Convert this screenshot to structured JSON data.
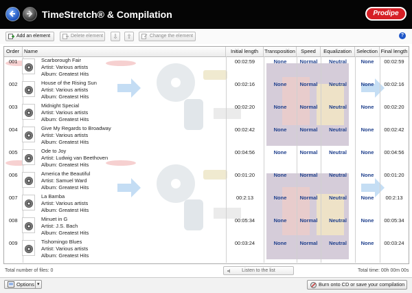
{
  "app": {
    "title": "TimeStretch® & Compilation",
    "logo_text": "Prodipe"
  },
  "toolbar": {
    "add_label": "Add an element",
    "delete_label": "Delete element",
    "change_label": "Change the element",
    "help_label": "?"
  },
  "columns": {
    "order": "Order",
    "name": "Name",
    "initial_length": "Initial length",
    "transposition": "Transposition",
    "speed": "Speed",
    "equalization": "Equalization",
    "selection": "Selection",
    "final_length": "Final length"
  },
  "rows": [
    {
      "order": "001",
      "title": "Scarborough Fair",
      "artist": "Artist: Various artists",
      "album": "Album: Greatest Hits",
      "initial": "00:02:59",
      "transposition": "None",
      "speed": "Normal",
      "equalization": "Neutral",
      "selection": "None",
      "final": "00:02:59"
    },
    {
      "order": "002",
      "title": "House of the Rising Sun",
      "artist": "Artist: Various artists",
      "album": "Album: Greatest Hits",
      "initial": "00:02:16",
      "transposition": "None",
      "speed": "Normal",
      "equalization": "Neutral",
      "selection": "None",
      "final": "00:02:16"
    },
    {
      "order": "003",
      "title": "Midnight Special",
      "artist": "Artist: Various artists",
      "album": "Album: Greatest Hits",
      "initial": "00:02:20",
      "transposition": "None",
      "speed": "Normal",
      "equalization": "Neutral",
      "selection": "None",
      "final": "00:02:20"
    },
    {
      "order": "004",
      "title": "Give My Regards to Broadway",
      "artist": "Artist: Various artists",
      "album": "Album: Greatest Hits",
      "initial": "00:02:42",
      "transposition": "None",
      "speed": "Normal",
      "equalization": "Neutral",
      "selection": "None",
      "final": "00:02:42"
    },
    {
      "order": "005",
      "title": "Ode to Joy",
      "artist": "Artist: Ludwig van Beethoven",
      "album": "Album: Greatest Hits",
      "initial": "00:04:56",
      "transposition": "None",
      "speed": "Normal",
      "equalization": "Neutral",
      "selection": "None",
      "final": "00:04:56"
    },
    {
      "order": "006",
      "title": "America the Beautiful",
      "artist": "Artist: Samuel Ward",
      "album": "Album: Greatest Hits",
      "initial": "00:01:20",
      "transposition": "None",
      "speed": "Normal",
      "equalization": "Neutral",
      "selection": "None",
      "final": "00:01:20"
    },
    {
      "order": "007",
      "title": "La Bamba",
      "artist": "Artist: Various artists",
      "album": "Album: Greatest Hits",
      "initial": "00:2:13",
      "transposition": "None",
      "speed": "Normal",
      "equalization": "Neutral",
      "selection": "None",
      "final": "00:2:13"
    },
    {
      "order": "008",
      "title": "Minuet in G",
      "artist": "Artist: J.S. Bach",
      "album": "Album: Greatest Hits",
      "initial": "00:05:34",
      "transposition": "None",
      "speed": "Normal",
      "equalization": "Neutral",
      "selection": "None",
      "final": "00:05:34"
    },
    {
      "order": "009",
      "title": "Tishomingo Blues",
      "artist": "Artist: Various artists",
      "album": "Album: Greatest Hits",
      "initial": "00:03:24",
      "transposition": "None",
      "speed": "Normal",
      "equalization": "Neutral",
      "selection": "None",
      "final": "00:03:24"
    }
  ],
  "status": {
    "file_count": "Total number of files: 0",
    "listen_label": "Listen to the list",
    "total_time": "Total time: 00h 00m 00s"
  },
  "footer": {
    "options_label": "Options",
    "burn_label": "Burn onto CD or save your compilation"
  },
  "colors": {
    "accent_blue": "#1e3f8c",
    "logo_red": "#d61f26",
    "titlebar": "#050505"
  }
}
